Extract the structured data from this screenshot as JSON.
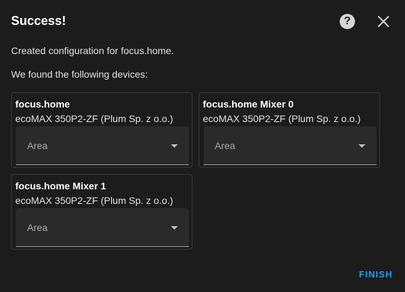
{
  "dialog": {
    "title": "Success!",
    "help_icon": "help-circle-icon",
    "close_icon": "close-icon",
    "intro_text": "Created configuration for focus.home.",
    "subintro_text": "We found the following devices:",
    "finish_label": "FINISH",
    "accent_color": "#1e9ee6"
  },
  "devices": [
    {
      "name": "focus.home",
      "model": "ecoMAX 350P2-ZF (Plum Sp. z o.o.)",
      "area_label": "Area"
    },
    {
      "name": "focus.home Mixer 0",
      "model": "ecoMAX 350P2-ZF (Plum Sp. z o.o.)",
      "area_label": "Area"
    },
    {
      "name": "focus.home Mixer 1",
      "model": "ecoMAX 350P2-ZF (Plum Sp. z o.o.)",
      "area_label": "Area"
    }
  ]
}
